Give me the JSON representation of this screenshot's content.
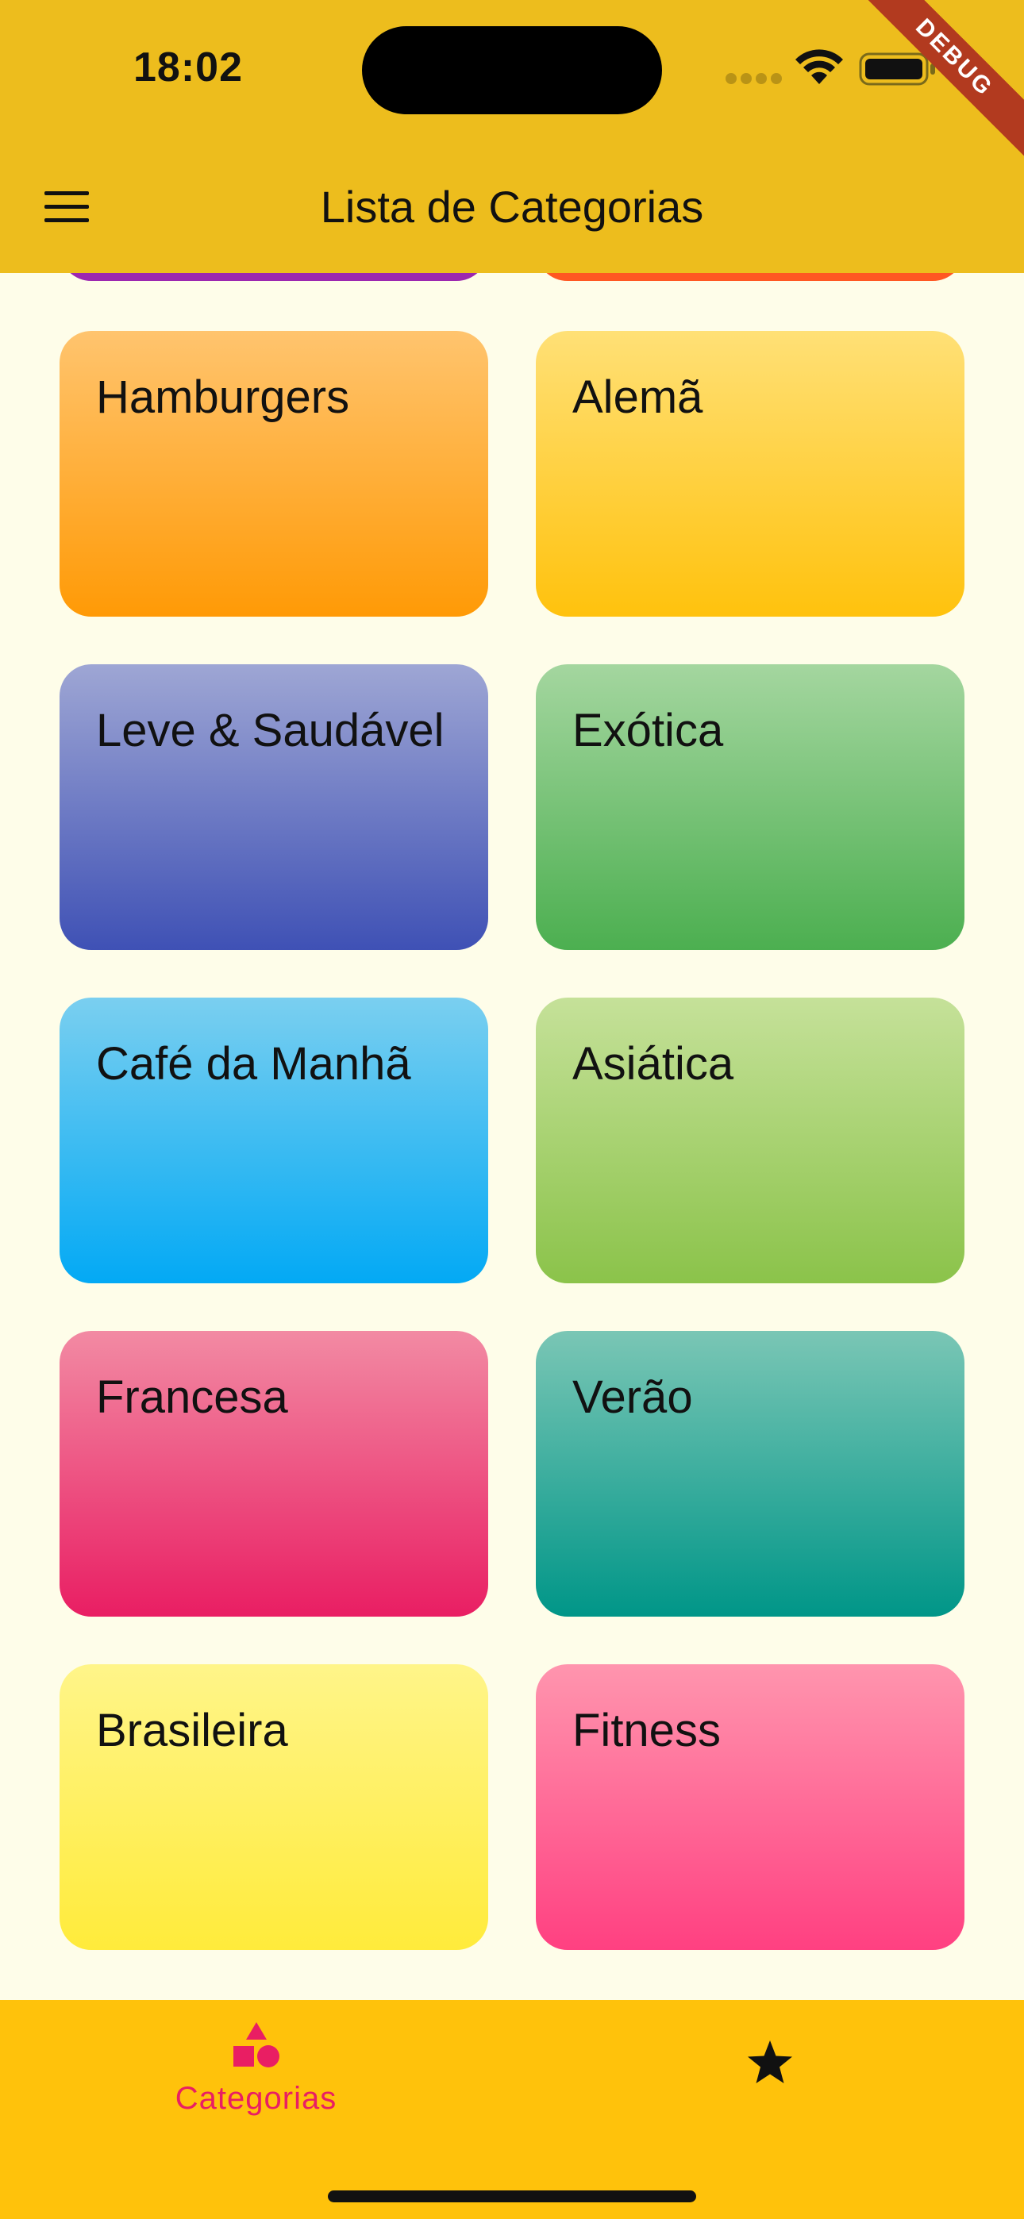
{
  "status_bar": {
    "time": "18:02",
    "debug_banner": "DEBUG"
  },
  "app_bar": {
    "title": "Lista de Categorias",
    "menu_icon": "menu-icon"
  },
  "colors": {
    "app_bar": "#EDBD1D",
    "background": "#FEFDE9",
    "bottom_nav": "#FFC20B",
    "accent": "#E91E63"
  },
  "categories": [
    {
      "title": "Hamburgers",
      "color_from": "#FFC46E",
      "color_to": "#FF9A06"
    },
    {
      "title": "Alemã",
      "color_from": "#FFE076",
      "color_to": "#FFC20D"
    },
    {
      "title": "Leve & Saudável",
      "color_from": "#9EA6D4",
      "color_to": "#3F51B5"
    },
    {
      "title": "Exótica",
      "color_from": "#A4D69F",
      "color_to": "#4CAF50"
    },
    {
      "title": "Café da Manhã",
      "color_from": "#7ACFF0",
      "color_to": "#03A9F4"
    },
    {
      "title": "Asiática",
      "color_from": "#C5E199",
      "color_to": "#8BC34A"
    },
    {
      "title": "Francesa",
      "color_from": "#F28AA3",
      "color_to": "#E91E63"
    },
    {
      "title": "Verão",
      "color_from": "#7AC6B5",
      "color_to": "#009688"
    },
    {
      "title": "Brasileira",
      "color_from": "#FFF589",
      "color_to": "#FFEB3B"
    },
    {
      "title": "Fitness",
      "color_from": "#FF95AE",
      "color_to": "#FF4081"
    }
  ],
  "partial_cards": [
    {
      "color": "#9C27B0"
    },
    {
      "color": "#FF5722"
    }
  ],
  "bottom_nav": {
    "items": [
      {
        "label": "Categorias",
        "icon": "category-icon",
        "selected": true
      },
      {
        "label": "",
        "icon": "star-icon",
        "selected": false
      }
    ]
  }
}
